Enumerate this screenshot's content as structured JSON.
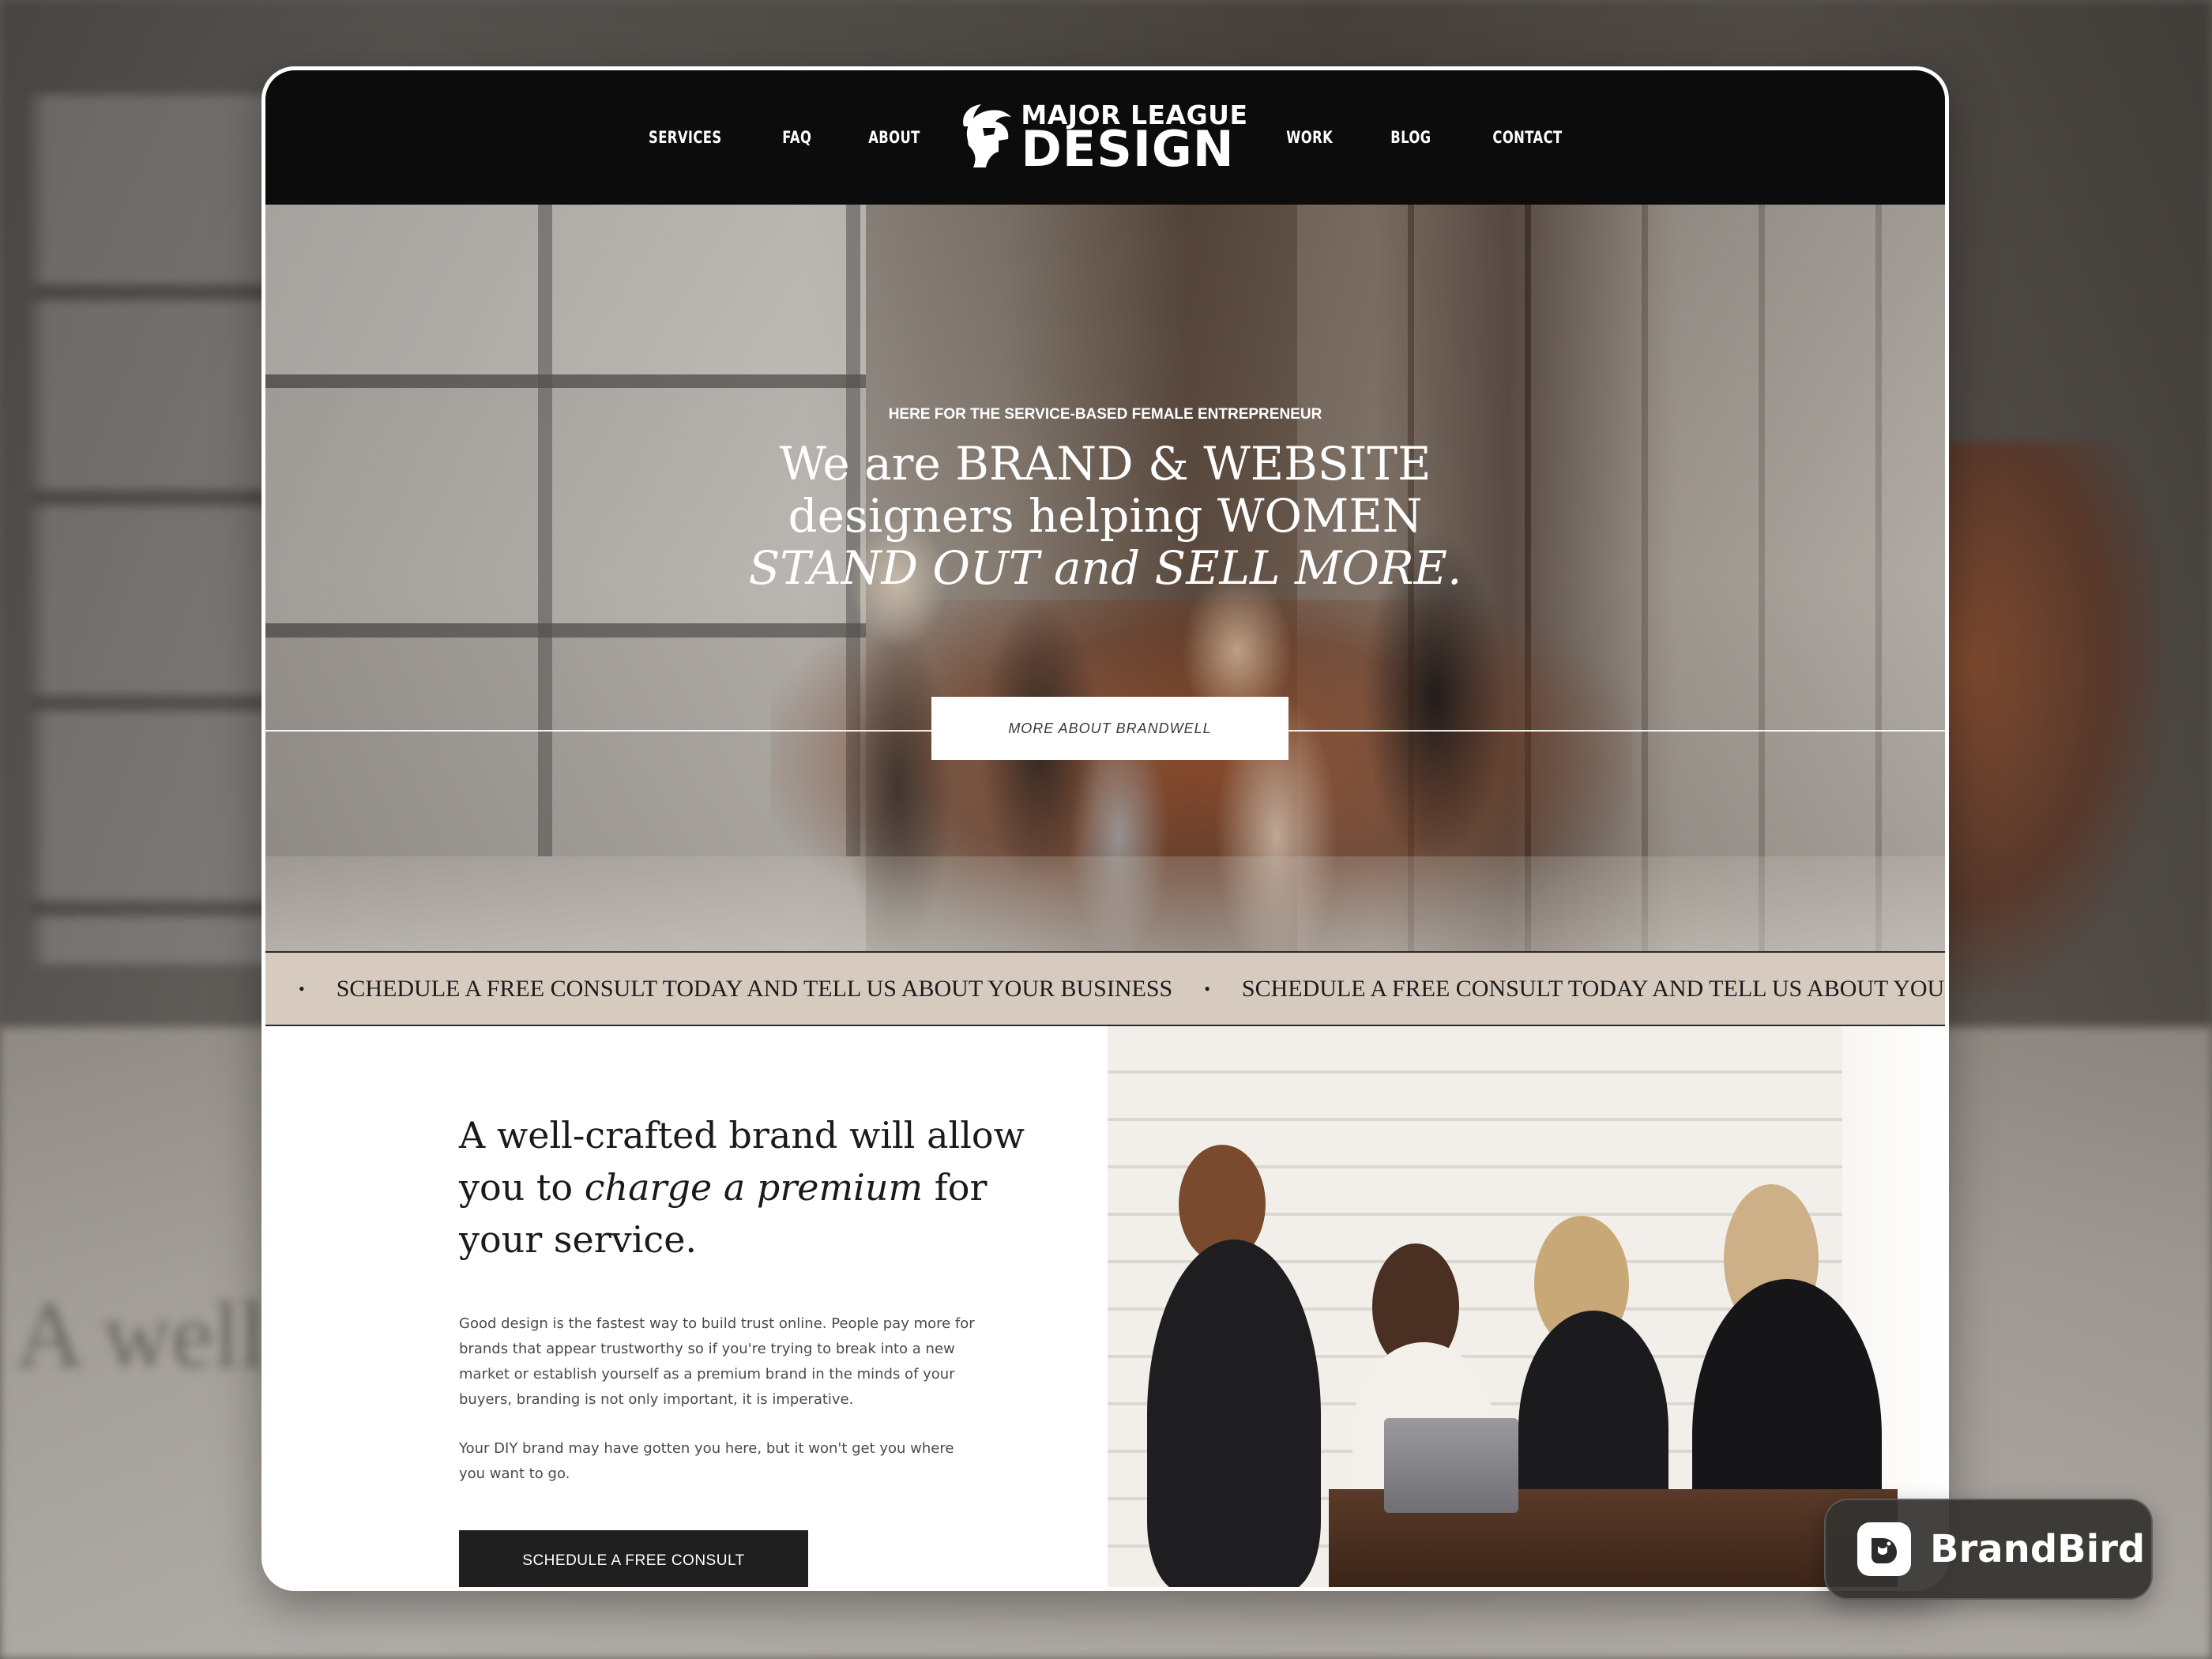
{
  "nav": {
    "items_left": [
      "SERVICES",
      "FAQ",
      "ABOUT"
    ],
    "items_right": [
      "WORK",
      "BLOG",
      "CONTACT"
    ],
    "logo_top": "MAJOR LEAGUE",
    "logo_bottom": "DESIGN"
  },
  "hero": {
    "eyebrow": "HERE FOR THE SERVICE-BASED FEMALE ENTREPRENEUR",
    "title_line1": "We are BRAND & WEBSITE",
    "title_line2": "designers helping WOMEN",
    "title_line3": "STAND OUT and SELL MORE.",
    "button_label": "MORE ABOUT BRANDWELL"
  },
  "marquee": {
    "text": "SCHEDULE A FREE CONSULT TODAY AND TELL US ABOUT YOUR BUSINESS",
    "text_truncated": "SCHEDULE A FREE CONSULT TODAY AND TELL US ABOUT YOUR I",
    "bullet": "•"
  },
  "section": {
    "heading_part1": "A well-crafted brand will allow you to ",
    "heading_italic": "charge a premium",
    "heading_part2": " for your service.",
    "paragraph1": "Good design is the fastest way to build trust online. People pay more for brands that appear trustworthy so if you're trying to break into a new market or establish yourself as a premium brand in the minds of your buyers, branding is not only important, it is imperative.",
    "paragraph2": "Your DIY brand may have gotten you here, but it won't get you where you want to go.",
    "cta_label": "SCHEDULE A FREE CONSULT"
  },
  "badge": {
    "label": "BrandBird"
  },
  "backdrop": {
    "text": "A well-cr"
  },
  "colors": {
    "nav_bg": "#0c0c0c",
    "marquee_bg": "#d7cbc0",
    "cta_bg": "#1f1f1f"
  }
}
